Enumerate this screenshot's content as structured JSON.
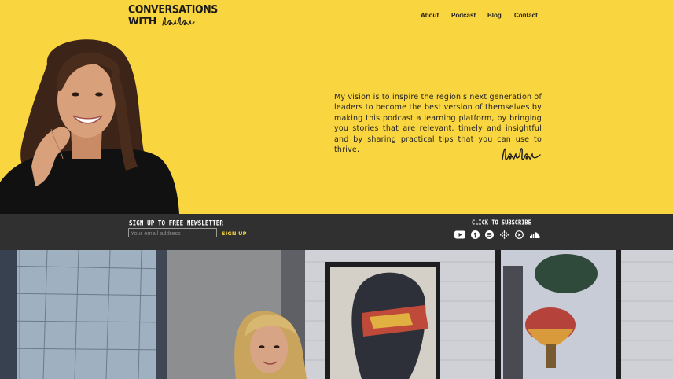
{
  "header": {
    "logo_line1": "CONVERSATIONS",
    "logo_line2": "WITH",
    "logo_script": "loulou"
  },
  "nav": {
    "about": "About",
    "podcast": "Podcast",
    "blog": "Blog",
    "contact": "Contact"
  },
  "hero": {
    "vision": "My vision is to inspire the region's next generation of leaders to become the best version of themselves by making this podcast a learning platform, by bringing you stories that are relevant, timely and insightful and by sharing practical tips that you can use to thrive.",
    "signature": "loulou"
  },
  "newsletter": {
    "title": "SIGN UP TO FREE NEWSLETTER",
    "placeholder": "Your email address",
    "button": "SIGN UP"
  },
  "subscribe": {
    "title": "CLICK TO SUBSCRIBE",
    "icons": [
      "youtube-icon",
      "podcast-icon",
      "spotify-icon",
      "google-podcasts-icon",
      "play-icon",
      "soundcloud-icon"
    ]
  },
  "colors": {
    "brand_yellow": "#f9d53f",
    "bar_dark": "#303030",
    "text_dark": "#1a1a1a"
  }
}
